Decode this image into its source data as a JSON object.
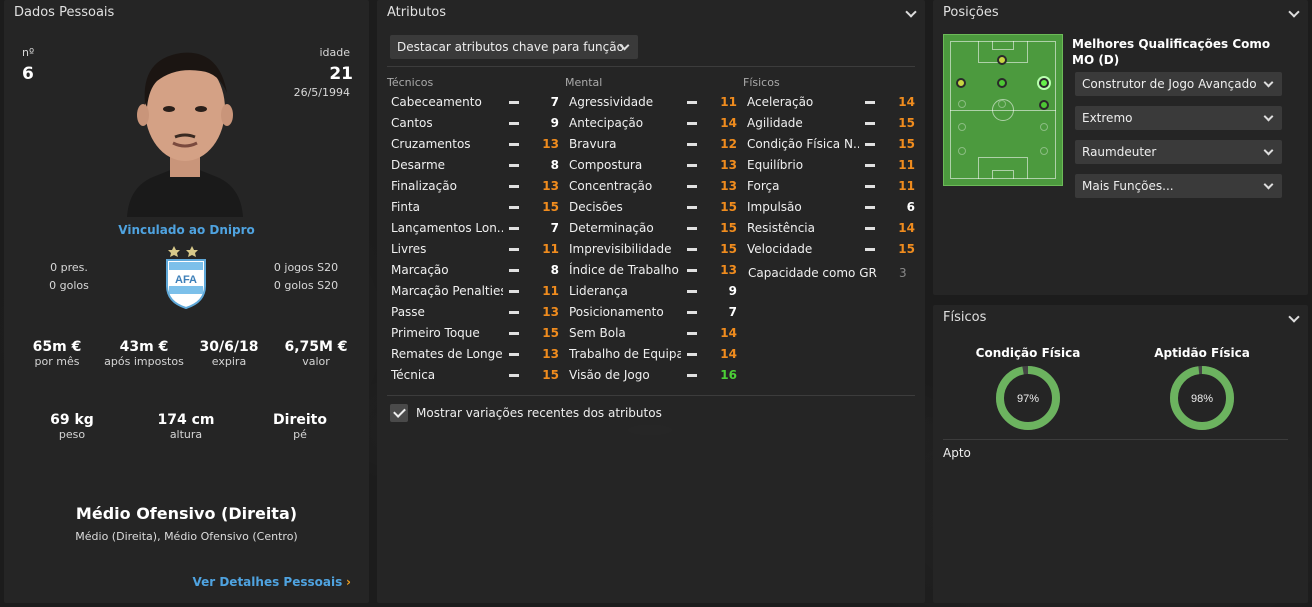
{
  "personal": {
    "title": "Dados Pessoais",
    "number_label": "nº",
    "number": "6",
    "age_label": "idade",
    "age": "21",
    "dob": "26/5/1994",
    "club_link": "Vinculado ao Dnipro",
    "caps_label": "0 pres.",
    "goals_label": "0 golos",
    "u20_caps": "0 jogos S20",
    "u20_goals": "0 golos S20",
    "finance": [
      {
        "value": "65m €",
        "label": "por mês"
      },
      {
        "value": "43m €",
        "label": "após impostos"
      },
      {
        "value": "30/6/18",
        "label": "expira"
      },
      {
        "value": "6,75M €",
        "label": "valor"
      }
    ],
    "body": [
      {
        "value": "69 kg",
        "label": "peso"
      },
      {
        "value": "174 cm",
        "label": "altura"
      },
      {
        "value": "Direito",
        "label": "pé"
      }
    ],
    "position_main": "Médio Ofensivo (Direita)",
    "position_other": "Médio (Direita), Médio Ofensivo (Centro)",
    "details_link": "Ver Detalhes Pessoais",
    "badge_text": "AFA"
  },
  "attributes": {
    "title": "Atributos",
    "highlight_dropdown": "Destacar atributos chave para função",
    "columns": [
      "Técnicos",
      "Mental",
      "Físicos"
    ],
    "technical": [
      {
        "name": "Cabeceamento",
        "value": "7",
        "color": "#ffffff"
      },
      {
        "name": "Cantos",
        "value": "9",
        "color": "#ffffff"
      },
      {
        "name": "Cruzamentos",
        "value": "13",
        "color": "#f08c1e"
      },
      {
        "name": "Desarme",
        "value": "8",
        "color": "#ffffff"
      },
      {
        "name": "Finalização",
        "value": "13",
        "color": "#f08c1e"
      },
      {
        "name": "Finta",
        "value": "15",
        "color": "#f08c1e"
      },
      {
        "name": "Lançamentos Lon...",
        "value": "7",
        "color": "#ffffff"
      },
      {
        "name": "Livres",
        "value": "11",
        "color": "#f08c1e"
      },
      {
        "name": "Marcação",
        "value": "8",
        "color": "#ffffff"
      },
      {
        "name": "Marcação Penalties",
        "value": "11",
        "color": "#f08c1e"
      },
      {
        "name": "Passe",
        "value": "13",
        "color": "#f08c1e"
      },
      {
        "name": "Primeiro Toque",
        "value": "15",
        "color": "#f08c1e"
      },
      {
        "name": "Remates de Longe",
        "value": "13",
        "color": "#f08c1e"
      },
      {
        "name": "Técnica",
        "value": "15",
        "color": "#f08c1e"
      }
    ],
    "mental": [
      {
        "name": "Agressividade",
        "value": "11",
        "color": "#f08c1e"
      },
      {
        "name": "Antecipação",
        "value": "14",
        "color": "#f08c1e"
      },
      {
        "name": "Bravura",
        "value": "12",
        "color": "#f08c1e"
      },
      {
        "name": "Compostura",
        "value": "13",
        "color": "#f08c1e"
      },
      {
        "name": "Concentração",
        "value": "13",
        "color": "#f08c1e"
      },
      {
        "name": "Decisões",
        "value": "15",
        "color": "#f08c1e"
      },
      {
        "name": "Determinação",
        "value": "15",
        "color": "#f08c1e"
      },
      {
        "name": "Imprevisibilidade",
        "value": "15",
        "color": "#f08c1e"
      },
      {
        "name": "Índice de Trabalho",
        "value": "13",
        "color": "#f08c1e"
      },
      {
        "name": "Liderança",
        "value": "9",
        "color": "#ffffff"
      },
      {
        "name": "Posicionamento",
        "value": "7",
        "color": "#ffffff"
      },
      {
        "name": "Sem Bola",
        "value": "14",
        "color": "#f08c1e"
      },
      {
        "name": "Trabalho de Equipa",
        "value": "14",
        "color": "#f08c1e"
      },
      {
        "name": "Visão de Jogo",
        "value": "16",
        "color": "#4cd137"
      }
    ],
    "physical": [
      {
        "name": "Aceleração",
        "value": "14",
        "color": "#f08c1e"
      },
      {
        "name": "Agilidade",
        "value": "15",
        "color": "#f08c1e"
      },
      {
        "name": "Condição Física N...",
        "value": "15",
        "color": "#f08c1e"
      },
      {
        "name": "Equilíbrio",
        "value": "11",
        "color": "#f08c1e"
      },
      {
        "name": "Força",
        "value": "11",
        "color": "#f08c1e"
      },
      {
        "name": "Impulsão",
        "value": "6",
        "color": "#ffffff"
      },
      {
        "name": "Resistência",
        "value": "14",
        "color": "#f08c1e"
      },
      {
        "name": "Velocidade",
        "value": "15",
        "color": "#f08c1e"
      }
    ],
    "gk_label": "Capacidade como GR",
    "gk_value": "3",
    "show_changes_label": "Mostrar variações recentes dos atributos"
  },
  "positions": {
    "title": "Posições",
    "best_title": "Melhores Qualificações Como MO (D)",
    "roles": [
      "Construtor de Jogo Avançado",
      "Extremo",
      "Raumdeuter",
      "Mais Funções..."
    ]
  },
  "physical": {
    "title": "Físicos",
    "condition_label": "Condição Física",
    "condition_value": "97%",
    "condition_fraction": 0.97,
    "fitness_label": "Aptidão Física",
    "fitness_value": "98%",
    "fitness_fraction": 0.98,
    "status": "Apto"
  },
  "colors": {
    "orange": "#f08c1e",
    "green": "#4cd137",
    "link": "#4fa3e0",
    "ring": "#6cb35f"
  }
}
